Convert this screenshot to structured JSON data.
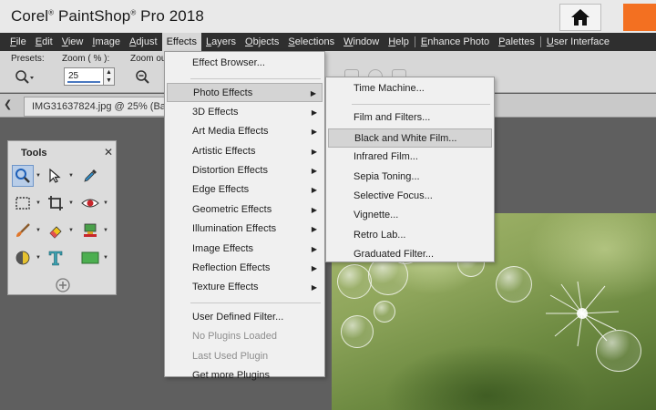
{
  "app": {
    "title_left": "Corel",
    "title_mid": "PaintShop",
    "title_right": "Pro 2018",
    "reg": "®"
  },
  "menubar": [
    {
      "key": "F",
      "rest": "ile",
      "id": "file"
    },
    {
      "key": "E",
      "rest": "dit",
      "id": "edit"
    },
    {
      "key": "V",
      "rest": "iew",
      "id": "view"
    },
    {
      "key": "I",
      "rest": "mage",
      "id": "image"
    },
    {
      "key": "A",
      "rest": "djust",
      "id": "adjust"
    },
    {
      "key": "",
      "rest": "Effects",
      "id": "effects",
      "active": true
    },
    {
      "key": "L",
      "rest": "ayers",
      "id": "layers"
    },
    {
      "key": "O",
      "rest": "bjects",
      "id": "objects"
    },
    {
      "key": "S",
      "rest": "elections",
      "id": "selections"
    },
    {
      "key": "W",
      "rest": "indow",
      "id": "window"
    },
    {
      "key": "H",
      "rest": "elp",
      "id": "help"
    },
    {
      "sep": true
    },
    {
      "key": "E",
      "rest": "nhance Photo",
      "id": "enhance-photo"
    },
    {
      "key": "P",
      "rest": "alettes",
      "id": "palettes"
    },
    {
      "sep": true
    },
    {
      "key": "U",
      "rest": "ser Interface",
      "id": "user-interface"
    }
  ],
  "toolbar": {
    "presets_label": "Presets:",
    "zoom_label": "Zoom ( % ):",
    "zoom_value": "25",
    "zoom_out_label": "Zoom ou"
  },
  "tab": {
    "document": "IMG31637824.jpg @  25% (Ba"
  },
  "tools_panel": {
    "title": "Tools",
    "close": "✕"
  },
  "effects_menu": {
    "items": [
      {
        "label": "Effect Browser...",
        "submenu": false
      },
      {
        "sep": true
      },
      {
        "label": "Photo Effects",
        "submenu": true,
        "highlight": true
      },
      {
        "label": "3D Effects",
        "submenu": true
      },
      {
        "label": "Art Media Effects",
        "submenu": true
      },
      {
        "label": "Artistic Effects",
        "submenu": true
      },
      {
        "label": "Distortion Effects",
        "submenu": true
      },
      {
        "label": "Edge Effects",
        "submenu": true
      },
      {
        "label": "Geometric Effects",
        "submenu": true
      },
      {
        "label": "Illumination Effects",
        "submenu": true
      },
      {
        "label": "Image Effects",
        "submenu": true
      },
      {
        "label": "Reflection Effects",
        "submenu": true
      },
      {
        "label": "Texture Effects",
        "submenu": true
      },
      {
        "sep": true
      },
      {
        "label": "User Defined Filter...",
        "submenu": false
      },
      {
        "label": "No Plugins Loaded",
        "submenu": false,
        "disabled": true
      },
      {
        "label": "Last Used Plugin",
        "submenu": false,
        "disabled": true
      },
      {
        "label": "Get more Plugins",
        "submenu": false
      }
    ]
  },
  "photo_effects_menu": {
    "items": [
      {
        "label": "Time Machine..."
      },
      {
        "sep": true
      },
      {
        "label": "Film and Filters..."
      },
      {
        "label": "Black and White Film...",
        "highlight": true
      },
      {
        "label": "Infrared Film..."
      },
      {
        "label": "Sepia Toning..."
      },
      {
        "label": "Selective Focus..."
      },
      {
        "label": "Vignette..."
      },
      {
        "label": "Retro Lab..."
      },
      {
        "label": "Graduated Filter..."
      }
    ]
  },
  "colors": {
    "accent_orange": "#f37021",
    "menubar_bg": "#2f2f2f",
    "highlight": "#d4d4d4"
  }
}
